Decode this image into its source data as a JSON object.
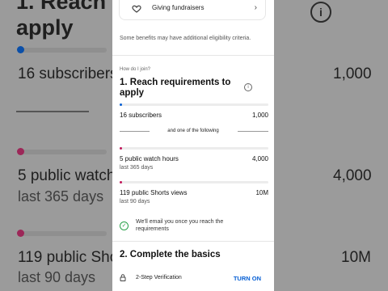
{
  "colors": {
    "sheet_bg": "#ffffff",
    "link": "#065fd4",
    "progress_blue": "#065fd4",
    "progress_pink": "#c2185b",
    "check_green": "#2aa24a"
  },
  "background": {
    "title": "1. Reach requirements to apply",
    "title_line1": "1. Reach r",
    "title_line2": "apply",
    "rows": [
      {
        "label": "16 subscribers",
        "value": "1,000"
      },
      {
        "label": "5 public watch",
        "sub": "last 365 days",
        "value": "4,000"
      },
      {
        "label": "119 public Sho",
        "sub": "last 90 days",
        "value": "10M"
      }
    ]
  },
  "sheet": {
    "benefit_label": "Giving fundraisers",
    "benefit_icon": "donation-hand-icon",
    "note": "Some benefits may have additional eligibility criteria.",
    "how_do_i_join": "How do I join?",
    "section1_title": "1. Reach requirements to apply",
    "requirements": {
      "subscribers": {
        "label": "16 subscribers",
        "value": "1,000",
        "progress": 0.016
      },
      "or_text": "and one of the following",
      "watch_hours": {
        "label": "5 public watch hours",
        "sub": "last 365 days",
        "value": "4,000",
        "progress": 0.00125
      },
      "shorts_views": {
        "label": "119 public Shorts views",
        "sub": "last 90 days",
        "value": "10M",
        "progress": 1.19e-05
      }
    },
    "email_notice": "We'll email you once you reach the requirements",
    "section2_title": "2. Complete the basics",
    "verification": {
      "label": "2-Step Verification",
      "action": "TURN ON"
    }
  }
}
